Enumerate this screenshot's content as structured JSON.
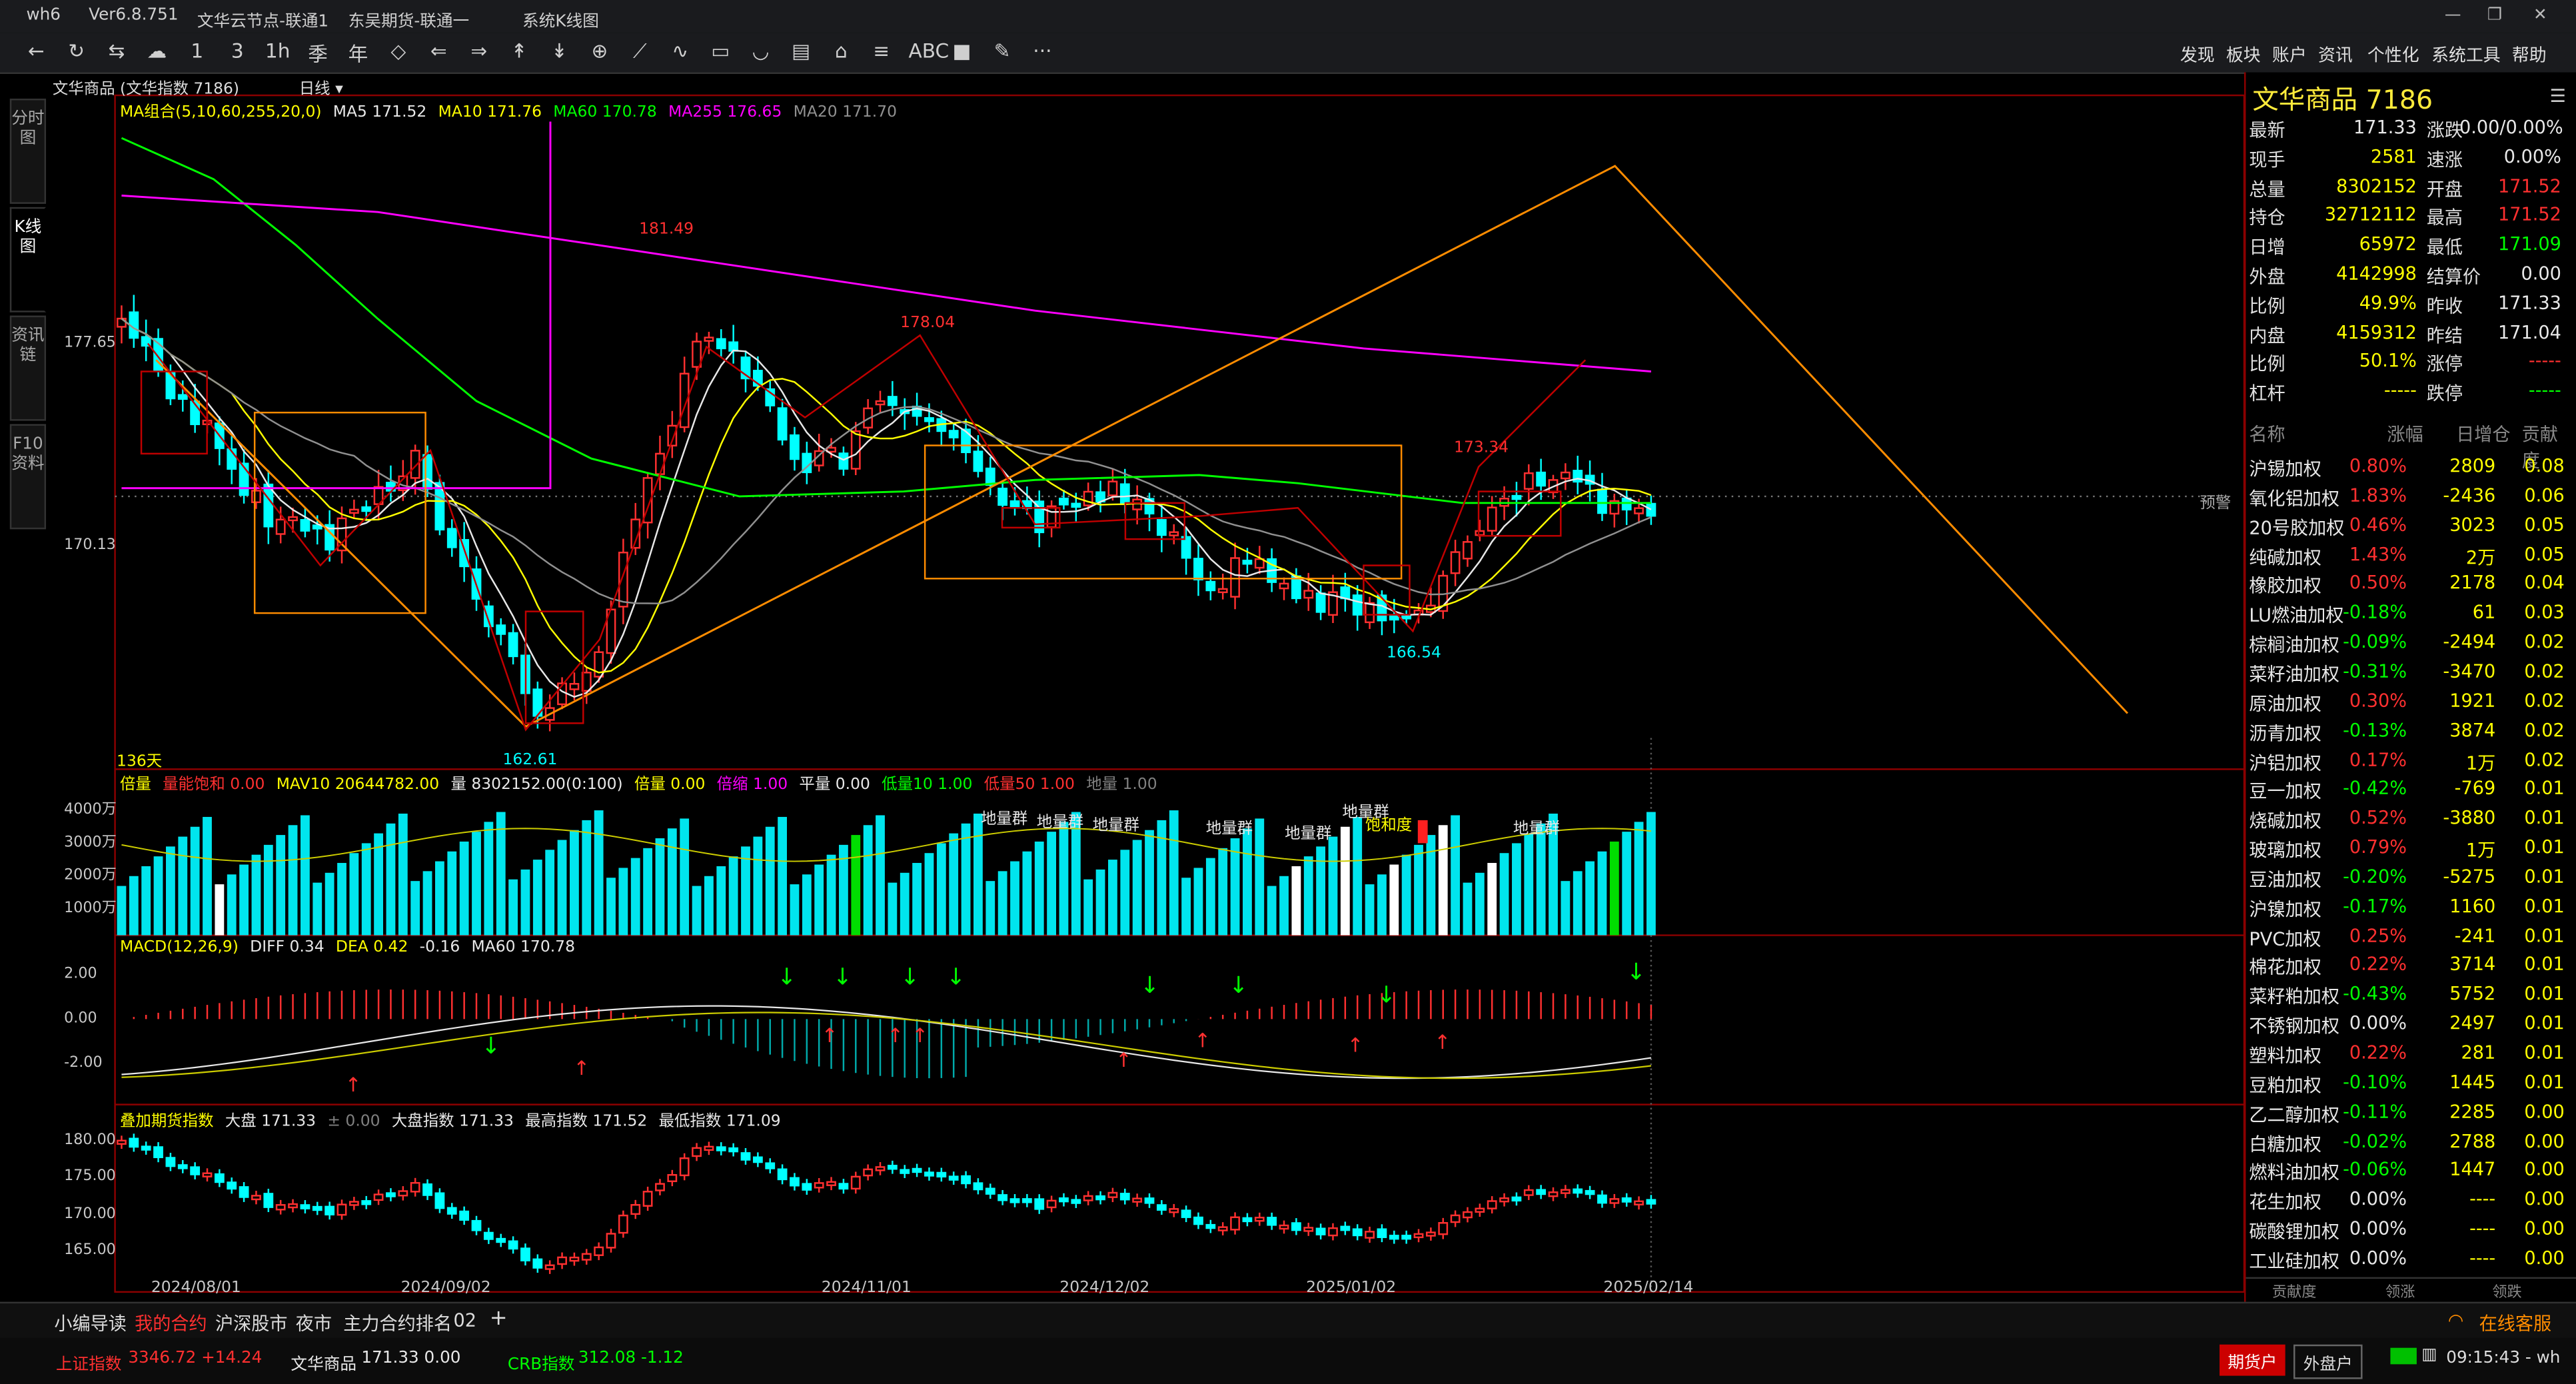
{
  "window": {
    "app": "wh6",
    "version": "Ver6.8.751",
    "server1": "文华云节点-联通1",
    "server2": "东吴期货-联通一",
    "screen": "系统K线图"
  },
  "menu": [
    "发现",
    "板块",
    "账户",
    "资讯",
    "个性化",
    "系统工具",
    "帮助"
  ],
  "toolbar_glyphs": [
    "←",
    "↻",
    "⇆",
    "☁",
    "1",
    "3",
    "1h",
    "季",
    "年",
    "◇",
    "⇐",
    "⇒",
    "↟",
    "↡",
    "⊕",
    "⟋",
    "∿",
    "▭",
    "◡",
    "▤",
    "⌂",
    "≡",
    "ABC",
    "■",
    "✎",
    "···"
  ],
  "side_tabs": [
    {
      "label": "分时图"
    },
    {
      "label": "K线图"
    },
    {
      "label": "资讯链"
    },
    {
      "label": "F10资料"
    }
  ],
  "header": {
    "contract": "文华商品 (文华指数 7186)",
    "period": "日线"
  },
  "ma_legend": [
    {
      "t": "MA组合(5,10,60,255,20,0)",
      "c": "#ffff00"
    },
    {
      "t": "MA5 171.52",
      "c": "#e8e8e8"
    },
    {
      "t": "MA10 171.76",
      "c": "#ffff00"
    },
    {
      "t": "MA60 170.78",
      "c": "#00ff00"
    },
    {
      "t": "MA255 176.65",
      "c": "#ff00ff"
    },
    {
      "t": "MA20 171.70",
      "c": "#909090"
    }
  ],
  "price_axis": {
    "top": "177.65",
    "mid": "170.13"
  },
  "price_marks": {
    "high1": "181.49",
    "high2": "178.04",
    "high3": "173.34",
    "low1": "162.61",
    "low2": "166.54",
    "days": "136天",
    "warn": "预警"
  },
  "vol_legend": [
    {
      "t": "倍量",
      "c": "#ffff00"
    },
    {
      "t": "量能饱和 0.00",
      "c": "#ff3030"
    },
    {
      "t": "MAV10 20644782.00",
      "c": "#ffff00"
    },
    {
      "t": "量 8302152.00(0:100)",
      "c": "#e8e8e8"
    },
    {
      "t": "倍量 0.00",
      "c": "#ffff00"
    },
    {
      "t": "倍缩 1.00",
      "c": "#ff00ff"
    },
    {
      "t": "平量 0.00",
      "c": "#e8e8e8"
    },
    {
      "t": "低量10 1.00",
      "c": "#00ff00"
    },
    {
      "t": "低量50 1.00",
      "c": "#ff3030"
    },
    {
      "t": "地量 1.00",
      "c": "#808080"
    }
  ],
  "vol_axis": [
    "4000万",
    "3000万",
    "2000万",
    "1000万"
  ],
  "vol_notes": [
    "地量群",
    "地量群",
    "地量群",
    "地量群",
    "地量群",
    "地量群",
    "饱和度",
    "地量群"
  ],
  "macd_legend": [
    {
      "t": "MACD(12,26,9)",
      "c": "#ffff00"
    },
    {
      "t": "DIFF 0.34",
      "c": "#e8e8e8"
    },
    {
      "t": "DEA 0.42",
      "c": "#ffff00"
    },
    {
      "t": "-0.16",
      "c": "#e8e8e8"
    },
    {
      "t": "MA60 170.78",
      "c": "#e8e8e8"
    }
  ],
  "macd_axis": [
    "2.00",
    "0.00",
    "-2.00"
  ],
  "overlay_legend": [
    {
      "t": "叠加期货指数",
      "c": "#ffff00"
    },
    {
      "t": "大盘 171.33",
      "c": "#e8e8e8"
    },
    {
      "t": "± 0.00",
      "c": "#808080"
    },
    {
      "t": "大盘指数 171.33",
      "c": "#e8e8e8"
    },
    {
      "t": "最高指数 171.52",
      "c": "#e8e8e8"
    },
    {
      "t": "最低指数 171.09",
      "c": "#e8e8e8"
    }
  ],
  "overlay_axis": [
    "180.00",
    "175.00",
    "170.00",
    "165.00"
  ],
  "dates": [
    "2024/08/01",
    "2024/09/02",
    "2024/11/01",
    "2024/12/02",
    "2025/01/02",
    "2025/02/14"
  ],
  "quote": {
    "title": "文华商品  7186",
    "rows": [
      {
        "l1": "最新",
        "v1": "171.33",
        "c1": "#e8e8e8",
        "l2": "涨跌",
        "v2": "0.00/0.00%",
        "c2": "#e8e8e8"
      },
      {
        "l1": "现手",
        "v1": "2581",
        "c1": "#ffff00",
        "l2": "速涨",
        "v2": "0.00%",
        "c2": "#e8e8e8"
      },
      {
        "l1": "总量",
        "v1": "8302152",
        "c1": "#ffff00",
        "l2": "开盘",
        "v2": "171.52",
        "c2": "#ff3030"
      },
      {
        "l1": "持仓",
        "v1": "32712112",
        "c1": "#ffff00",
        "l2": "最高",
        "v2": "171.52",
        "c2": "#ff3030"
      },
      {
        "l1": "日增",
        "v1": "65972",
        "c1": "#ffff00",
        "l2": "最低",
        "v2": "171.09",
        "c2": "#00ff00"
      },
      {
        "l1": "外盘",
        "v1": "4142998",
        "c1": "#ffff00",
        "l2": "结算价",
        "v2": "0.00",
        "c2": "#e8e8e8"
      },
      {
        "l1": "比例",
        "v1": "49.9%",
        "c1": "#ffff00",
        "l2": "昨收",
        "v2": "171.33",
        "c2": "#e8e8e8"
      },
      {
        "l1": "内盘",
        "v1": "4159312",
        "c1": "#ffff00",
        "l2": "昨结",
        "v2": "171.04",
        "c2": "#e8e8e8"
      },
      {
        "l1": "比例",
        "v1": "50.1%",
        "c1": "#ffff00",
        "l2": "涨停",
        "v2": "-----",
        "c2": "#ff3030"
      },
      {
        "l1": "杠杆",
        "v1": "-----",
        "c1": "#ffff00",
        "l2": "跌停",
        "v2": "-----",
        "c2": "#00ff00"
      }
    ]
  },
  "list_header": [
    "名称",
    "涨幅",
    "日增仓",
    "贡献度"
  ],
  "list": [
    {
      "n": "沪锡加权",
      "p": "0.80%",
      "pc": "#ff3030",
      "d": "2809",
      "g": "0.08"
    },
    {
      "n": "氧化铝加权",
      "p": "1.83%",
      "pc": "#ff3030",
      "d": "-2436",
      "g": "0.06"
    },
    {
      "n": "20号胶加权",
      "p": "0.46%",
      "pc": "#ff3030",
      "d": "3023",
      "g": "0.05"
    },
    {
      "n": "纯碱加权",
      "p": "1.43%",
      "pc": "#ff3030",
      "d": "2万",
      "g": "0.05"
    },
    {
      "n": "橡胶加权",
      "p": "0.50%",
      "pc": "#ff3030",
      "d": "2178",
      "g": "0.04"
    },
    {
      "n": "LU燃油加权",
      "p": "-0.18%",
      "pc": "#00ff00",
      "d": "61",
      "g": "0.03"
    },
    {
      "n": "棕榈油加权",
      "p": "-0.09%",
      "pc": "#00ff00",
      "d": "-2494",
      "g": "0.02"
    },
    {
      "n": "菜籽油加权",
      "p": "-0.31%",
      "pc": "#00ff00",
      "d": "-3470",
      "g": "0.02"
    },
    {
      "n": "原油加权",
      "p": "0.30%",
      "pc": "#ff3030",
      "d": "1921",
      "g": "0.02"
    },
    {
      "n": "沥青加权",
      "p": "-0.13%",
      "pc": "#00ff00",
      "d": "3874",
      "g": "0.02"
    },
    {
      "n": "沪铝加权",
      "p": "0.17%",
      "pc": "#ff3030",
      "d": "1万",
      "g": "0.02"
    },
    {
      "n": "豆一加权",
      "p": "-0.42%",
      "pc": "#00ff00",
      "d": "-769",
      "g": "0.01"
    },
    {
      "n": "烧碱加权",
      "p": "0.52%",
      "pc": "#ff3030",
      "d": "-3880",
      "g": "0.01"
    },
    {
      "n": "玻璃加权",
      "p": "0.79%",
      "pc": "#ff3030",
      "d": "1万",
      "g": "0.01"
    },
    {
      "n": "豆油加权",
      "p": "-0.20%",
      "pc": "#00ff00",
      "d": "-5275",
      "g": "0.01"
    },
    {
      "n": "沪镍加权",
      "p": "-0.17%",
      "pc": "#00ff00",
      "d": "1160",
      "g": "0.01"
    },
    {
      "n": "PVC加权",
      "p": "0.25%",
      "pc": "#ff3030",
      "d": "-241",
      "g": "0.01"
    },
    {
      "n": "棉花加权",
      "p": "0.22%",
      "pc": "#ff3030",
      "d": "3714",
      "g": "0.01"
    },
    {
      "n": "菜籽粕加权",
      "p": "-0.43%",
      "pc": "#00ff00",
      "d": "5752",
      "g": "0.01"
    },
    {
      "n": "不锈钢加权",
      "p": "0.00%",
      "pc": "#e8e8e8",
      "d": "2497",
      "g": "0.01"
    },
    {
      "n": "塑料加权",
      "p": "0.22%",
      "pc": "#ff3030",
      "d": "281",
      "g": "0.01"
    },
    {
      "n": "豆粕加权",
      "p": "-0.10%",
      "pc": "#00ff00",
      "d": "1445",
      "g": "0.01"
    },
    {
      "n": "乙二醇加权",
      "p": "-0.11%",
      "pc": "#00ff00",
      "d": "2285",
      "g": "0.00"
    },
    {
      "n": "白糖加权",
      "p": "-0.02%",
      "pc": "#00ff00",
      "d": "2788",
      "g": "0.00"
    },
    {
      "n": "燃料油加权",
      "p": "-0.06%",
      "pc": "#00ff00",
      "d": "1447",
      "g": "0.00"
    },
    {
      "n": "花生加权",
      "p": "0.00%",
      "pc": "#e8e8e8",
      "d": "----",
      "g": "0.00"
    },
    {
      "n": "碳酸锂加权",
      "p": "0.00%",
      "pc": "#e8e8e8",
      "d": "----",
      "g": "0.00"
    },
    {
      "n": "工业硅加权",
      "p": "0.00%",
      "pc": "#e8e8e8",
      "d": "----",
      "g": "0.00"
    }
  ],
  "list_tabs": [
    "贡献度",
    "领涨",
    "领跌"
  ],
  "bottom_tabs": [
    "小编导读",
    "我的合约",
    "沪深股市",
    "夜市",
    "主力合约排名",
    "02",
    "+"
  ],
  "service": "在线客服",
  "status": {
    "sh": "上证指数",
    "sh_v": "3346.72 +14.24",
    "wh": "文华商品",
    "wh_v": "171.33 0.00",
    "crb": "CRB指数",
    "crb_v": "312.08 -1.12",
    "btn1": "期货户",
    "btn2": "外盘户",
    "time": "09:15:43 - wh"
  },
  "colors": {
    "up": "#ff3030",
    "down": "#00ffff",
    "ma5": "#e8e8e8",
    "ma10": "#ffff00",
    "ma60": "#00ff00",
    "ma255": "#ff00ff",
    "ma20": "#909090",
    "box": "#ff8c00",
    "border": "#8b0000"
  }
}
